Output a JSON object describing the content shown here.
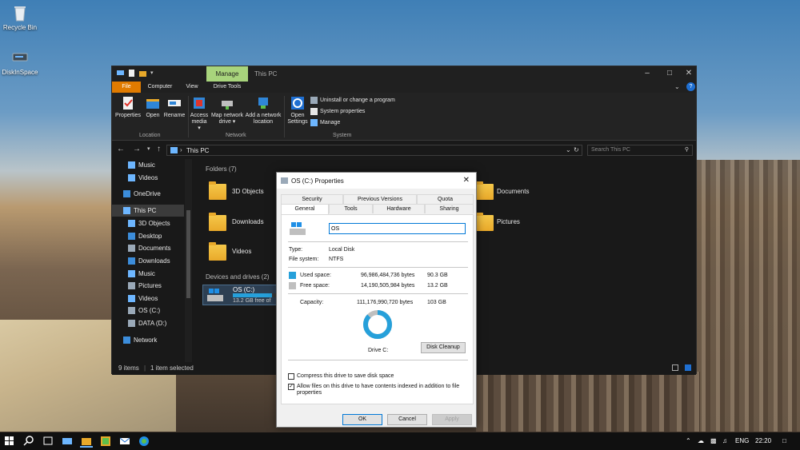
{
  "desktop": {
    "icons": [
      {
        "label": "Recycle Bin"
      },
      {
        "label": "DiskInSpace"
      }
    ]
  },
  "explorer": {
    "title": "This PC",
    "contextual_tab": "Manage",
    "menu": [
      "File",
      "Computer",
      "View",
      "Drive Tools"
    ],
    "ribbon": {
      "location_buttons": [
        "Properties",
        "Open",
        "Rename"
      ],
      "location_group": "Location",
      "network_buttons": [
        {
          "l1": "Access",
          "l2": "media ▾"
        },
        {
          "l1": "Map network",
          "l2": "drive ▾"
        },
        {
          "l1": "Add a network",
          "l2": "location"
        }
      ],
      "network_group": "Network",
      "open_settings": {
        "l1": "Open",
        "l2": "Settings"
      },
      "system_items": [
        "Uninstall or change a program",
        "System properties",
        "Manage"
      ],
      "system_group": "System"
    },
    "address": "This PC",
    "search_placeholder": "Search This PC",
    "nav": [
      {
        "label": "Music",
        "icon": "music-icon",
        "color": "#6db6ff"
      },
      {
        "label": "Videos",
        "icon": "videos-icon",
        "color": "#6db6ff"
      },
      {
        "label": "OneDrive",
        "icon": "onedrive-icon",
        "color": "#3c8ddb"
      },
      {
        "label": "This PC",
        "icon": "this-pc-icon",
        "color": "#6db6ff"
      },
      {
        "label": "3D Objects",
        "icon": "3d-objects-icon",
        "color": "#6db6ff"
      },
      {
        "label": "Desktop",
        "icon": "desktop-icon",
        "color": "#3c8ddb"
      },
      {
        "label": "Documents",
        "icon": "documents-icon",
        "color": "#9aa9b8"
      },
      {
        "label": "Downloads",
        "icon": "downloads-icon",
        "color": "#3c8ddb"
      },
      {
        "label": "Music",
        "icon": "music-icon",
        "color": "#6db6ff"
      },
      {
        "label": "Pictures",
        "icon": "pictures-icon",
        "color": "#9aa9b8"
      },
      {
        "label": "Videos",
        "icon": "videos-icon",
        "color": "#6db6ff"
      },
      {
        "label": "OS (C:)",
        "icon": "drive-icon",
        "color": "#9aa9b8"
      },
      {
        "label": "DATA (D:)",
        "icon": "drive-icon",
        "color": "#9aa9b8"
      },
      {
        "label": "Network",
        "icon": "network-icon",
        "color": "#3c8ddb"
      }
    ],
    "folders_header": "Folders (7)",
    "folders": [
      "3D Objects",
      "Documents",
      "Downloads",
      "Pictures",
      "Videos"
    ],
    "devices_header": "Devices and drives (2)",
    "drive": {
      "name": "OS (C:)",
      "free": "13.2 GB free of"
    },
    "status": {
      "items": "9 items",
      "selected": "1 item selected"
    }
  },
  "dialog": {
    "title": "OS (C:) Properties",
    "tabs_row1": [
      "Security",
      "Previous Versions",
      "Quota"
    ],
    "tabs_row2": [
      "General",
      "Tools",
      "Hardware",
      "Sharing"
    ],
    "name_value": "OS",
    "type_label": "Type:",
    "type_value": "Local Disk",
    "fs_label": "File system:",
    "fs_value": "NTFS",
    "used_label": "Used space:",
    "used_bytes": "96,986,484,736 bytes",
    "used_gb": "90.3 GB",
    "free_label": "Free space:",
    "free_bytes": "14,190,505,984 bytes",
    "free_gb": "13.2 GB",
    "capacity_label": "Capacity:",
    "capacity_bytes": "111,176,990,720 bytes",
    "capacity_gb": "103 GB",
    "drive_label": "Drive C:",
    "disk_cleanup": "Disk Cleanup",
    "compress_label": "Compress this drive to save disk space",
    "compress_checked": false,
    "index_label_1": "Allow files on this drive to have contents indexed in addition to file",
    "index_label_2": "properties",
    "index_checked": true,
    "used_color": "#26a0da",
    "free_color": "#bfbfbf",
    "used_fraction": 0.872,
    "ok": "OK",
    "cancel": "Cancel",
    "apply": "Apply"
  },
  "taskbar": {
    "language": "ENG",
    "time": "22:20"
  }
}
